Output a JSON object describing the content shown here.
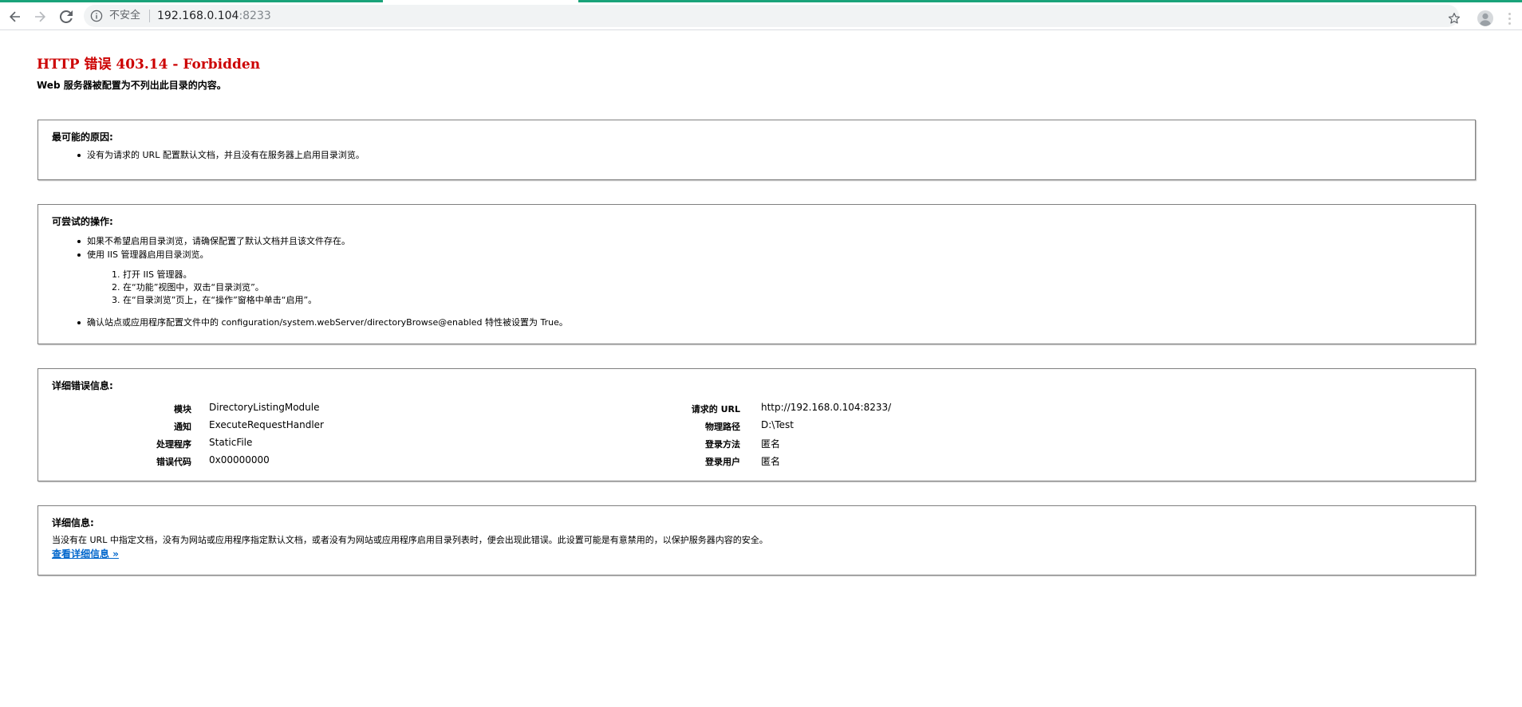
{
  "browser": {
    "security_label": "不安全",
    "url_host": "192.168.0.104",
    "url_port": ":8233",
    "colors": {
      "loadbar": "#1aa37a",
      "omnibox_bg": "#f1f3f4"
    },
    "icons": [
      "back-arrow-icon",
      "forward-arrow-icon",
      "reload-icon",
      "info-icon",
      "star-icon",
      "profile-avatar-icon",
      "menu-dots-icon"
    ]
  },
  "error": {
    "title": "HTTP 错误 403.14 - Forbidden",
    "subtitle": "Web 服务器被配置为不列出此目录的内容。"
  },
  "cause": {
    "heading": "最可能的原因:",
    "items": [
      "没有为请求的 URL 配置默认文档，并且没有在服务器上启用目录浏览。"
    ]
  },
  "actions": {
    "heading": "可尝试的操作:",
    "items": [
      "如果不希望启用目录浏览，请确保配置了默认文档并且该文件存在。",
      "使用 IIS 管理器启用目录浏览。",
      "确认站点或应用程序配置文件中的 configuration/system.webServer/directoryBrowse@enabled 特性被设置为 True。"
    ],
    "steps": [
      "1. 打开 IIS 管理器。",
      "2. 在“功能”视图中，双击“目录浏览”。",
      "3. 在“目录浏览”页上，在“操作”窗格中单击“启用”。"
    ]
  },
  "details": {
    "heading": "详细错误信息:",
    "left": [
      {
        "label": "模块",
        "value": "DirectoryListingModule"
      },
      {
        "label": "通知",
        "value": "ExecuteRequestHandler"
      },
      {
        "label": "处理程序",
        "value": "StaticFile"
      },
      {
        "label": "错误代码",
        "value": "0x00000000"
      }
    ],
    "right": [
      {
        "label": "请求的 URL",
        "value": "http://192.168.0.104:8233/"
      },
      {
        "label": "物理路径",
        "value": "D:\\Test"
      },
      {
        "label": "登录方法",
        "value": "匿名"
      },
      {
        "label": "登录用户",
        "value": "匿名"
      }
    ]
  },
  "more_info": {
    "heading": "详细信息:",
    "text": "当没有在 URL 中指定文档，没有为网站或应用程序指定默认文档，或者没有为网站或应用程序启用目录列表时，便会出现此错误。此设置可能是有意禁用的，以保护服务器内容的安全。",
    "link": "查看详细信息 »"
  }
}
